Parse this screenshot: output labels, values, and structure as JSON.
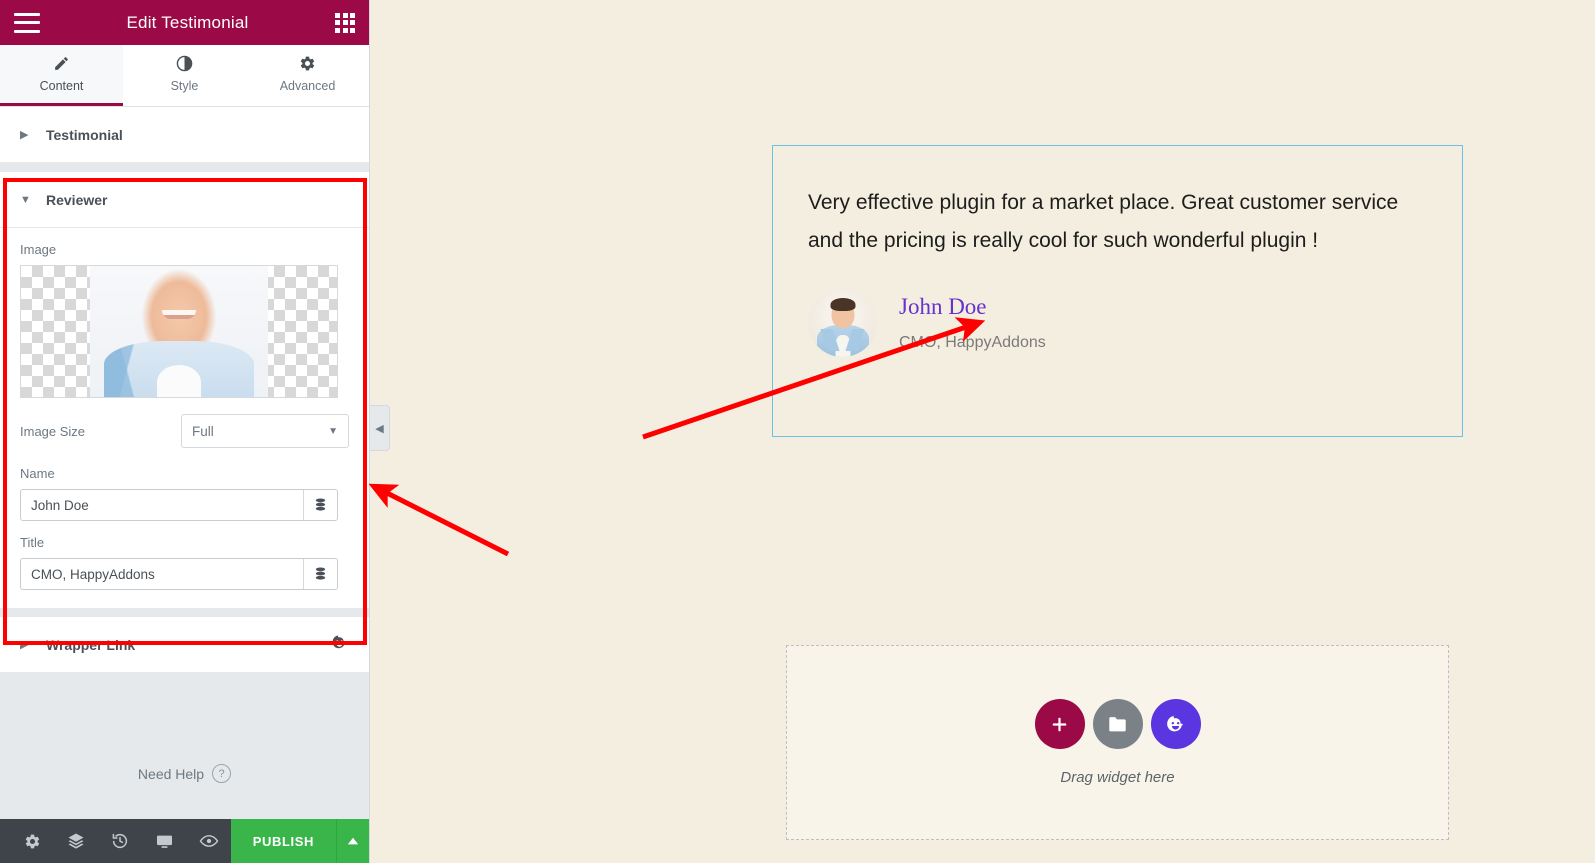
{
  "panel": {
    "header": {
      "title": "Edit Testimonial",
      "menu_icon": "hamburger-icon",
      "apps_icon": "grid-icon"
    },
    "tabs": [
      {
        "label": "Content",
        "icon": "pencil-icon",
        "active": true
      },
      {
        "label": "Style",
        "icon": "contrast-icon",
        "active": false
      },
      {
        "label": "Advanced",
        "icon": "gear-icon",
        "active": false
      }
    ],
    "sections": [
      {
        "label": "Testimonial",
        "expanded": false
      },
      {
        "label": "Reviewer",
        "expanded": true
      },
      {
        "label": "Wrapper Link",
        "expanded": false,
        "icon": "happy-face-icon"
      }
    ],
    "reviewer": {
      "image_label": "Image",
      "image_size_label": "Image Size",
      "image_size_value": "Full",
      "name_label": "Name",
      "name_value": "John Doe",
      "title_label": "Title",
      "title_value": "CMO, HappyAddons",
      "dynamic_tag_icon": "database-stack-icon"
    },
    "need_help": "Need Help",
    "help_icon": "question-mark-icon",
    "bottom_bar": {
      "icons": [
        "gear-icon",
        "layers-icon",
        "history-icon",
        "responsive-icon",
        "preview-eye-icon"
      ],
      "publish_label": "PUBLISH",
      "publish_arrow_icon": "chevron-up-icon"
    },
    "collapse_handle_icon": "chevron-left-icon"
  },
  "canvas": {
    "widget": {
      "quote": "Very effective plugin for a market place. Great customer service and the pricing is really cool for such wonderful plugin !",
      "reviewer_name": "John Doe",
      "reviewer_title": "CMO, HappyAddons",
      "avatar_icon": "avatar",
      "border_color": "#6ec1e4",
      "name_color": "#6633cc"
    },
    "dropzone": {
      "caption": "Drag widget here",
      "buttons": [
        {
          "name": "add-section-button",
          "icon": "plus-icon",
          "color": "#9b0a46"
        },
        {
          "name": "template-library-button",
          "icon": "folder-icon",
          "color": "#7a8288"
        },
        {
          "name": "happy-addons-button",
          "icon": "happy-face-icon",
          "color": "#5b35e0"
        }
      ]
    },
    "background_color": "#f4eee0"
  },
  "annotations": {
    "highlight_color": "#ff0000",
    "arrow_count": 2
  }
}
